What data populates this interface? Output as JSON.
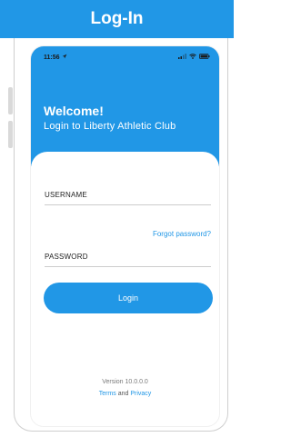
{
  "header": {
    "title": "Log-In"
  },
  "status_bar": {
    "time": "11:56"
  },
  "hero": {
    "welcome": "Welcome!",
    "subtitle": "Login to Liberty Athletic Club"
  },
  "form": {
    "username_label": "USERNAME",
    "forgot_password": "Forgot password?",
    "password_label": "PASSWORD",
    "login_button": "Login"
  },
  "footer": {
    "version": "Version 10.0.0.0",
    "terms": "Terms",
    "and": "and",
    "privacy": "Privacy"
  },
  "colors": {
    "brand_blue": "#2197e6",
    "white": "#ffffff"
  },
  "icons": [
    "location-arrow-icon",
    "signal-icon",
    "wifi-icon",
    "battery-icon"
  ]
}
